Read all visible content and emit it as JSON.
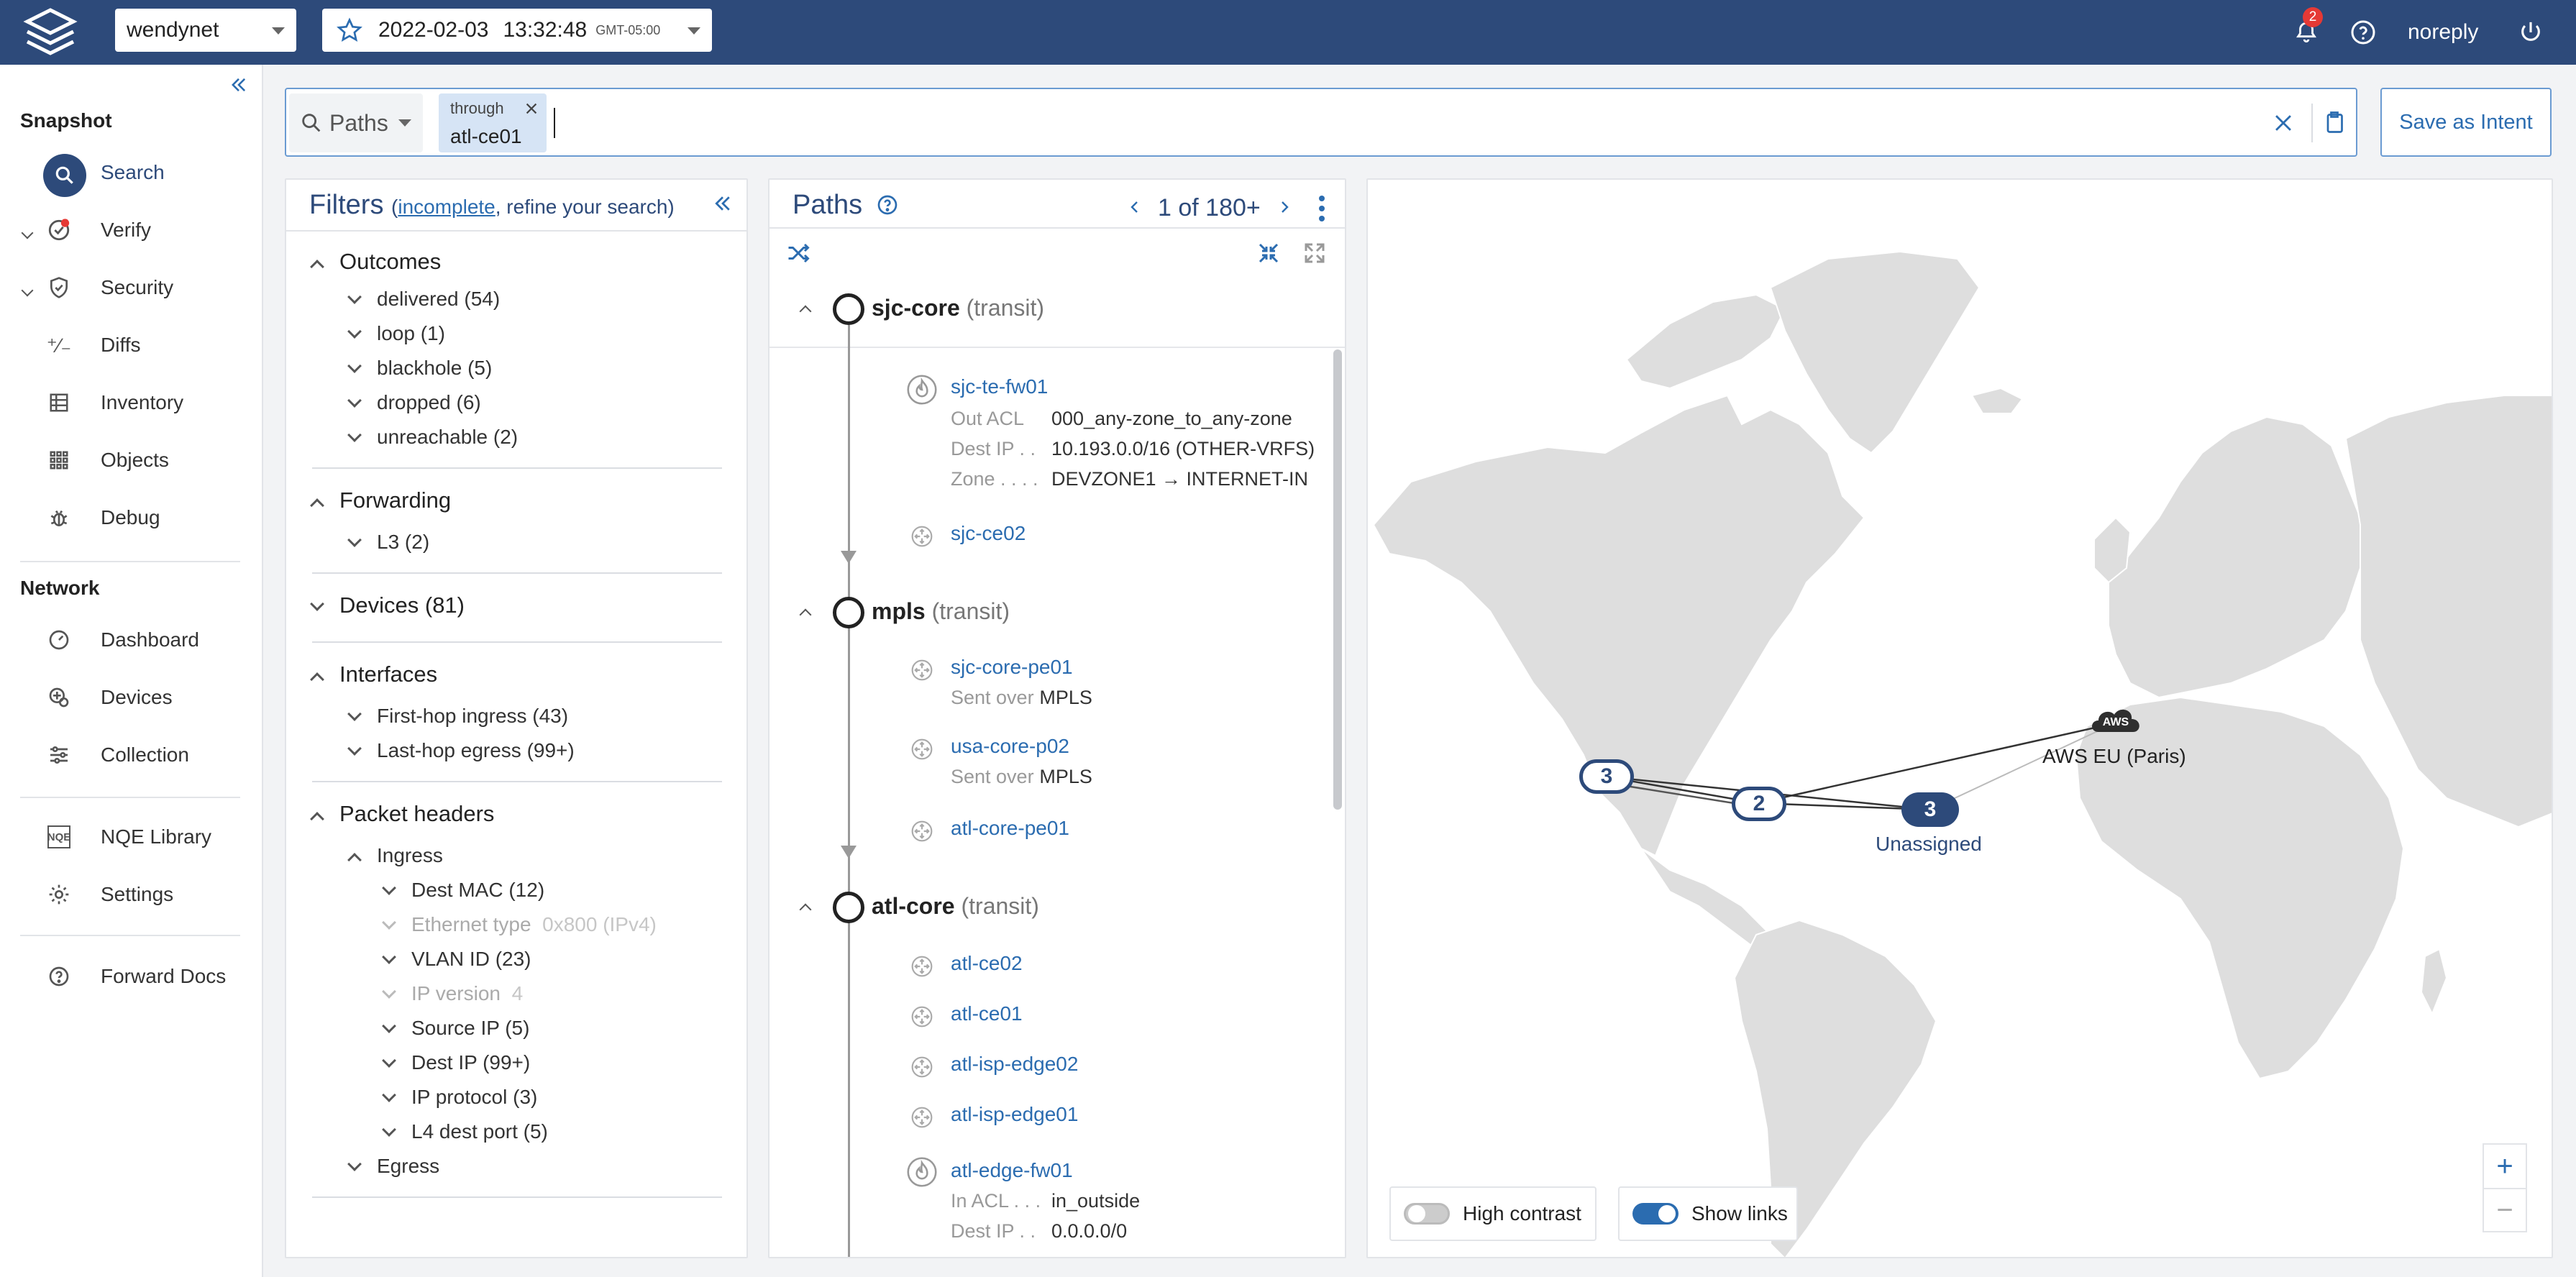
{
  "topbar": {
    "network": "wendynet",
    "snapshot_date": "2022-02-03",
    "snapshot_time": "13:32:48",
    "timezone": "GMT-05:00",
    "notifications_count": "2",
    "user": "noreply"
  },
  "sidebar": {
    "snapshot_heading": "Snapshot",
    "snapshot_items": [
      {
        "label": "Search",
        "icon": "search-icon",
        "active": true
      },
      {
        "label": "Verify",
        "icon": "verify-icon"
      },
      {
        "label": "Security",
        "icon": "shield-icon"
      },
      {
        "label": "Diffs",
        "icon": "diffs-icon"
      },
      {
        "label": "Inventory",
        "icon": "inventory-icon"
      },
      {
        "label": "Objects",
        "icon": "grid-icon"
      },
      {
        "label": "Debug",
        "icon": "bug-icon"
      }
    ],
    "network_heading": "Network",
    "network_items": [
      {
        "label": "Dashboard",
        "icon": "gauge-icon"
      },
      {
        "label": "Devices",
        "icon": "devices-icon"
      },
      {
        "label": "Collection",
        "icon": "sliders-icon"
      }
    ],
    "extra_items": [
      {
        "label": "NQE Library",
        "icon": "nqe-icon"
      },
      {
        "label": "Settings",
        "icon": "gear-icon"
      }
    ],
    "docs_item": {
      "label": "Forward Docs",
      "icon": "help-icon"
    }
  },
  "search": {
    "mode": "Paths",
    "chip_key": "through",
    "chip_value": "atl-ce01",
    "save_label": "Save as Intent"
  },
  "filters": {
    "title": "Filters",
    "sub_open": "(",
    "sub_link": "incomplete",
    "sub_rest": ", refine your search)",
    "outcomes_label": "Outcomes",
    "outcomes": [
      "delivered (54)",
      "loop (1)",
      "blackhole (5)",
      "dropped (6)",
      "unreachable (2)"
    ],
    "forwarding_label": "Forwarding",
    "forwarding": [
      "L3 (2)"
    ],
    "devices_label": "Devices (81)",
    "interfaces_label": "Interfaces",
    "interfaces": [
      "First-hop ingress (43)",
      "Last-hop egress (99+)"
    ],
    "packet_label": "Packet headers",
    "ingress_label": "Ingress",
    "ingress": [
      {
        "label": "Dest MAC (12)",
        "muted": false
      },
      {
        "label": "Ethernet type",
        "value": "0x800 (IPv4)",
        "muted": true
      },
      {
        "label": "VLAN ID (23)",
        "muted": false
      },
      {
        "label": "IP version",
        "value": "4",
        "muted": true
      },
      {
        "label": "Source IP (5)",
        "muted": false
      },
      {
        "label": "Dest IP (99+)",
        "muted": false
      },
      {
        "label": "IP protocol (3)",
        "muted": false
      },
      {
        "label": "L4 dest port (5)",
        "muted": false
      }
    ],
    "egress_label": "Egress"
  },
  "paths": {
    "title": "Paths",
    "pager": "1 of 180+",
    "nodes": [
      {
        "name": "sjc-core",
        "role": "(transit)",
        "hops": [
          {
            "name": "sjc-te-fw01",
            "kind": "firewall",
            "details": [
              {
                "k": "Out ACL",
                "v": "000_any-zone_to_any-zone"
              },
              {
                "k": "Dest IP",
                "v": "10.193.0.0/16 (OTHER-VRFS)"
              },
              {
                "k": "Zone",
                "v": "DEVZONE1 → INTERNET-IN"
              }
            ]
          },
          {
            "name": "sjc-ce02",
            "kind": "router",
            "details": []
          }
        ]
      },
      {
        "name": "mpls",
        "role": "(transit)",
        "hops": [
          {
            "name": "sjc-core-pe01",
            "kind": "router",
            "details": [
              {
                "k": "Sent over",
                "v": "MPLS"
              }
            ]
          },
          {
            "name": "usa-core-p02",
            "kind": "router",
            "details": [
              {
                "k": "Sent over",
                "v": "MPLS"
              }
            ]
          },
          {
            "name": "atl-core-pe01",
            "kind": "router",
            "details": []
          }
        ]
      },
      {
        "name": "atl-core",
        "role": "(transit)",
        "hops": [
          {
            "name": "atl-ce02",
            "kind": "router",
            "details": []
          },
          {
            "name": "atl-ce01",
            "kind": "router",
            "details": []
          },
          {
            "name": "atl-isp-edge02",
            "kind": "router",
            "details": []
          },
          {
            "name": "atl-isp-edge01",
            "kind": "router",
            "details": []
          },
          {
            "name": "atl-edge-fw01",
            "kind": "firewall",
            "details": [
              {
                "k": "In ACL",
                "v": "in_outside"
              },
              {
                "k": "Dest IP",
                "v": "0.0.0.0/0"
              }
            ]
          }
        ]
      }
    ]
  },
  "map": {
    "clusters": [
      "3",
      "2",
      "3"
    ],
    "unassigned_label": "Unassigned",
    "aws_badge": "AWS",
    "aws_label": "AWS EU (Paris)",
    "high_contrast_label": "High contrast",
    "show_links_label": "Show links",
    "high_contrast_on": false,
    "show_links_on": true,
    "zoom_in": "+",
    "zoom_out": "−"
  }
}
